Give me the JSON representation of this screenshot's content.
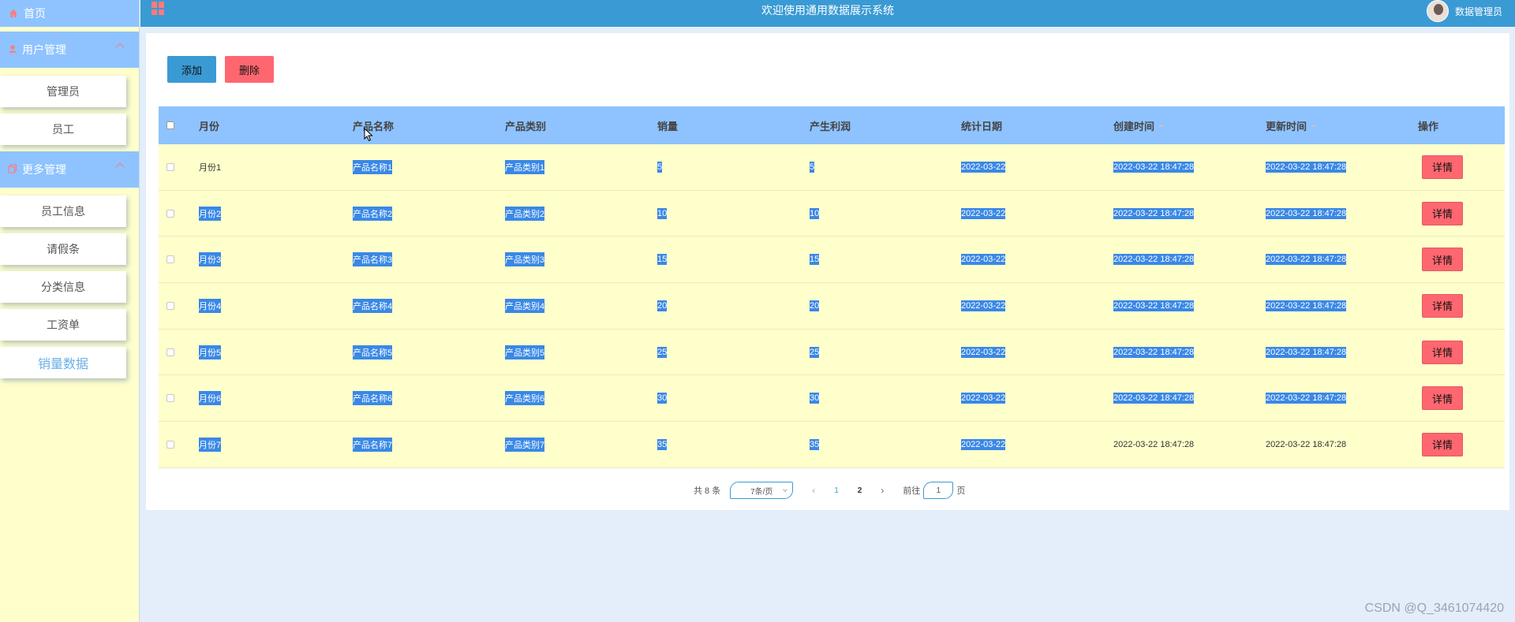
{
  "sidebar": {
    "home": "首页",
    "groups": [
      {
        "label": "用户管理",
        "items": [
          "管理员",
          "员工"
        ]
      },
      {
        "label": "更多管理",
        "items": [
          "员工信息",
          "请假条",
          "分类信息",
          "工资单",
          "销量数据"
        ]
      }
    ],
    "active_item": "销量数据"
  },
  "topbar": {
    "title": "欢迎使用通用数据展示系统",
    "user": "数据管理员"
  },
  "toolbar": {
    "add": "添加",
    "delete": "删除"
  },
  "table": {
    "columns": [
      "月份",
      "产品名称",
      "产品类别",
      "销量",
      "产生利润",
      "统计日期",
      "创建时间",
      "更新时间",
      "操作"
    ],
    "detail_label": "详情",
    "rows": [
      {
        "month": "月份1",
        "name": "产品名称1",
        "category": "产品类别1",
        "qty": "5",
        "profit": "5",
        "date": "2022-03-22",
        "created": "2022-03-22 18:47:28",
        "updated": "2022-03-22 18:47:28"
      },
      {
        "month": "月份2",
        "name": "产品名称2",
        "category": "产品类别2",
        "qty": "10",
        "profit": "10",
        "date": "2022-03-22",
        "created": "2022-03-22 18:47:28",
        "updated": "2022-03-22 18:47:28"
      },
      {
        "month": "月份3",
        "name": "产品名称3",
        "category": "产品类别3",
        "qty": "15",
        "profit": "15",
        "date": "2022-03-22",
        "created": "2022-03-22 18:47:28",
        "updated": "2022-03-22 18:47:28"
      },
      {
        "month": "月份4",
        "name": "产品名称4",
        "category": "产品类别4",
        "qty": "20",
        "profit": "20",
        "date": "2022-03-22",
        "created": "2022-03-22 18:47:28",
        "updated": "2022-03-22 18:47:28"
      },
      {
        "month": "月份5",
        "name": "产品名称5",
        "category": "产品类别5",
        "qty": "25",
        "profit": "25",
        "date": "2022-03-22",
        "created": "2022-03-22 18:47:28",
        "updated": "2022-03-22 18:47:28"
      },
      {
        "month": "月份6",
        "name": "产品名称6",
        "category": "产品类别6",
        "qty": "30",
        "profit": "30",
        "date": "2022-03-22",
        "created": "2022-03-22 18:47:28",
        "updated": "2022-03-22 18:47:28"
      },
      {
        "month": "月份7",
        "name": "产品名称7",
        "category": "产品类别7",
        "qty": "35",
        "profit": "35",
        "date": "2022-03-22",
        "created": "2022-03-22 18:47:28",
        "updated": "2022-03-22 18:47:28"
      }
    ]
  },
  "pagination": {
    "total": "共 8 条",
    "page_size": "7条/页",
    "pages": [
      "1",
      "2"
    ],
    "goto_label": "前往",
    "goto_value": "1",
    "page_suffix": "页"
  },
  "watermark": "CSDN @Q_3461074420",
  "colors": {
    "sidebar_bg": "#ffffcc",
    "menu_header": "#8ec3ff",
    "topbar": "#3a9ad4",
    "danger": "#ff6770",
    "selection": "#3a88e6"
  }
}
